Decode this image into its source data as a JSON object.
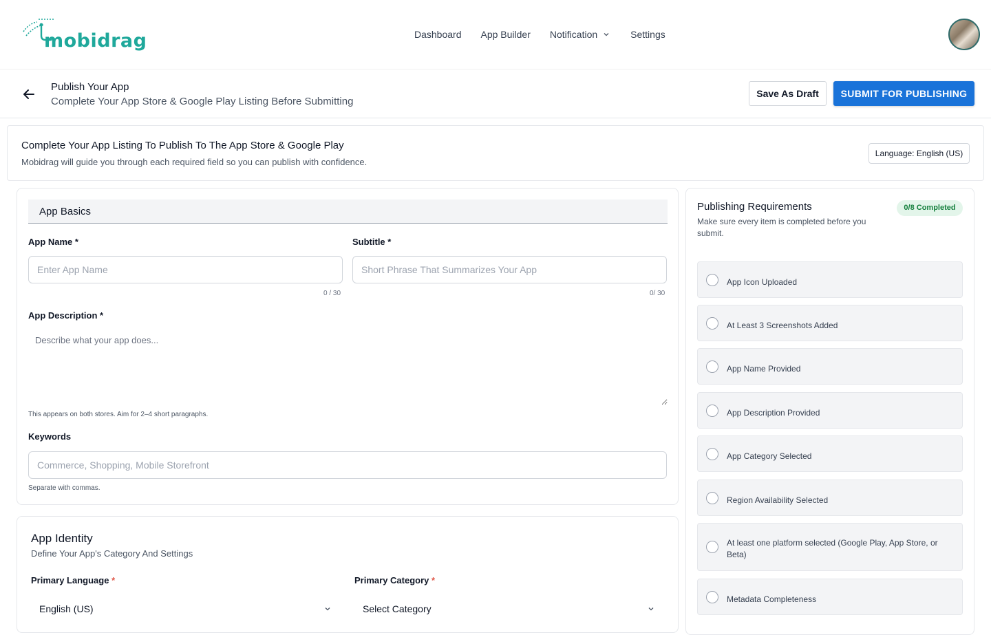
{
  "brand": {
    "name": "mobidrag",
    "color": "#1fa89b"
  },
  "nav": {
    "items": [
      {
        "label": "Dashboard"
      },
      {
        "label": "App Builder"
      },
      {
        "label": "Notification"
      },
      {
        "label": "Settings"
      }
    ]
  },
  "page": {
    "title": "Publish Your App",
    "subtitle": "Complete Your App Store & Google Play Listing Before Submitting",
    "save_draft_label": "Save As Draft",
    "submit_label": "SUBMIT FOR PUBLISHING"
  },
  "banner": {
    "title": "Complete Your App Listing To Publish To The App Store & Google Play",
    "subtitle": "Mobidrag will guide you through each required field so you can publish with confidence.",
    "language_label": "Language: English (US)"
  },
  "basics": {
    "heading": "App Basics",
    "app_name_label": "App Name *",
    "app_name_placeholder": "Enter App Name",
    "app_name_counter": "0 / 30",
    "subtitle_label": "Subtitle *",
    "subtitle_placeholder": "Short Phrase That Summarizes Your App",
    "subtitle_counter": "0/ 30",
    "description_label": "App Description *",
    "description_placeholder": "Describe what your app does...",
    "description_helper": "This appears on both stores. Aim for 2–4 short paragraphs.",
    "keywords_label": "Keywords",
    "keywords_placeholder": "Commerce, Shopping, Mobile Storefront",
    "keywords_helper": "Separate with commas."
  },
  "identity": {
    "heading": "App Identity",
    "subheading": "Define Your App's Category And Settings",
    "primary_language_label": "Primary Language",
    "primary_language_value": "English (US)",
    "primary_category_label": "Primary Category",
    "primary_category_value": "Select Category",
    "required_mark": "*"
  },
  "requirements": {
    "title": "Publishing Requirements",
    "subtitle": "Make sure every item is completed before you submit.",
    "badge": "0/8 Completed",
    "items": [
      {
        "label": "App Icon Uploaded"
      },
      {
        "label": "At Least 3 Screenshots Added"
      },
      {
        "label": "App Name Provided"
      },
      {
        "label": "App Description Provided"
      },
      {
        "label": "App Category Selected"
      },
      {
        "label": "Region Availability Selected"
      },
      {
        "label": "At least one platform selected (Google Play, App Store, or Beta)"
      },
      {
        "label": "Metadata Completeness"
      }
    ]
  },
  "colors": {
    "primary": "#1a73d9",
    "success_bg": "#e3f5ea",
    "success_text": "#15803d"
  }
}
